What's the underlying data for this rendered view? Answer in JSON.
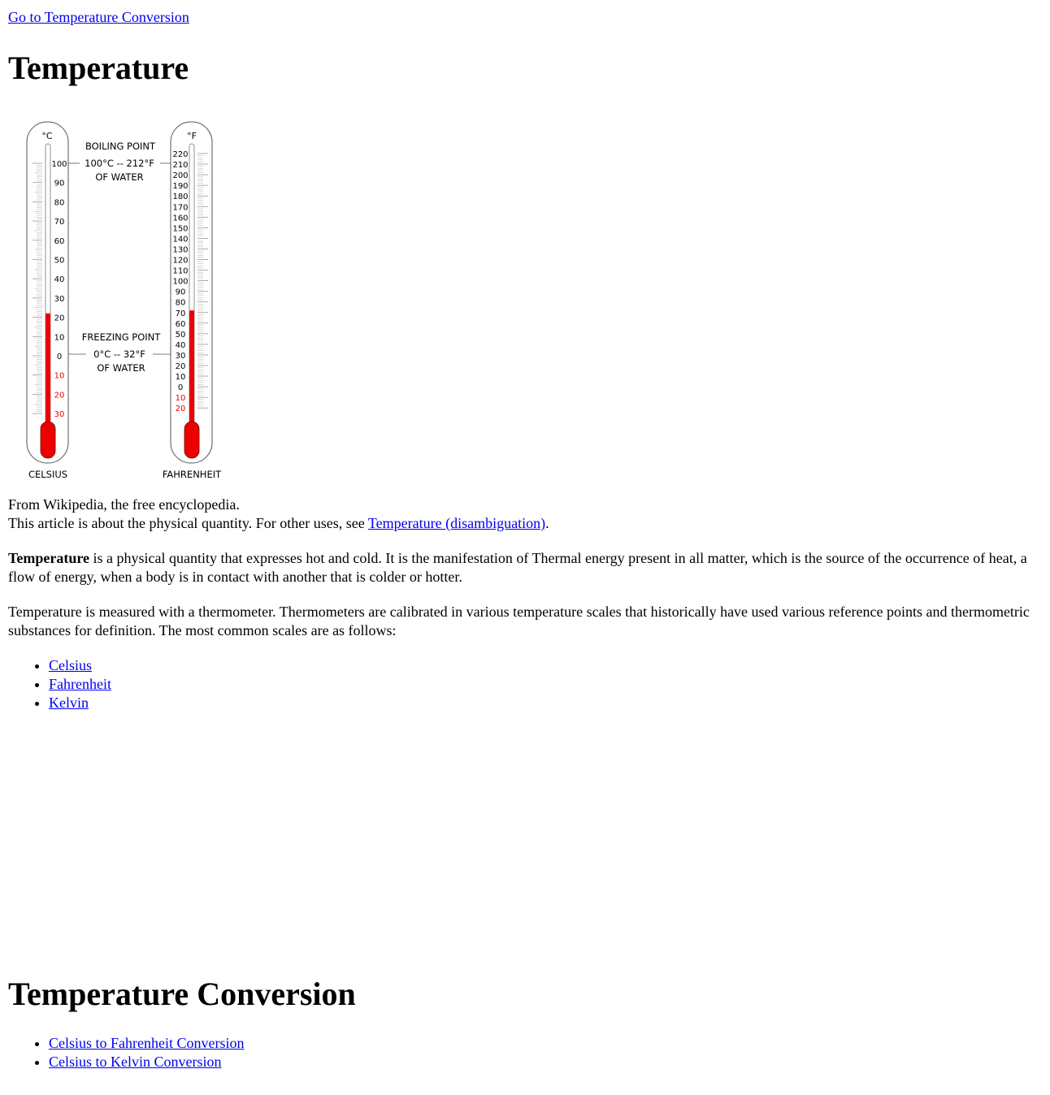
{
  "nav": {
    "top_link": "Go to Temperature Conversion"
  },
  "heading": "Temperature",
  "figure": {
    "celsius_unit": "°C",
    "fahrenheit_unit": "°F",
    "celsius_label": "CELSIUS",
    "fahrenheit_label": "FAHRENHEIT",
    "boiling": {
      "line1": "BOILING POINT",
      "line2": "100°C -- 212°F",
      "line3": "OF WATER"
    },
    "freezing": {
      "line1": "FREEZING POINT",
      "line2": "0°C -- 32°F",
      "line3": "OF WATER"
    },
    "celsius_ticks": [
      "100",
      "90",
      "80",
      "70",
      "60",
      "50",
      "40",
      "30",
      "20",
      "10",
      "0",
      "10",
      "20",
      "30"
    ],
    "celsius_negative_from_index": 11,
    "fahrenheit_ticks": [
      "220",
      "210",
      "200",
      "190",
      "180",
      "170",
      "160",
      "150",
      "140",
      "130",
      "120",
      "110",
      "100",
      "90",
      "80",
      "70",
      "60",
      "50",
      "40",
      "30",
      "20",
      "10",
      "0",
      "10",
      "20"
    ],
    "fahrenheit_negative_from_index": 23,
    "reading_celsius": 22,
    "reading_fahrenheit": 72,
    "mercury_color": "#ee0000"
  },
  "source_line": "From Wikipedia, the free encyclopedia.",
  "about_text": "This article is about the physical quantity. For other uses, see ",
  "about_link": "Temperature (disambiguation)",
  "about_end": ".",
  "intro_bold": "Temperature",
  "intro_rest": " is a physical quantity that expresses hot and cold. It is the manifestation of Thermal energy present in all matter, which is the source of the occurrence of heat, a flow of energy, when a body is in contact with another that is colder or hotter.",
  "measure_text": "Temperature is measured with a thermometer. Thermometers are calibrated in various temperature scales that historically have used various reference points and thermometric substances for definition. The most common scales are as follows:",
  "scales": [
    "Celsius",
    "Fahrenheit",
    "Kelvin"
  ],
  "conversion_heading": "Temperature Conversion",
  "conversions": [
    "Celsius to Fahrenheit Conversion",
    "Celsius to Kelvin Conversion"
  ]
}
